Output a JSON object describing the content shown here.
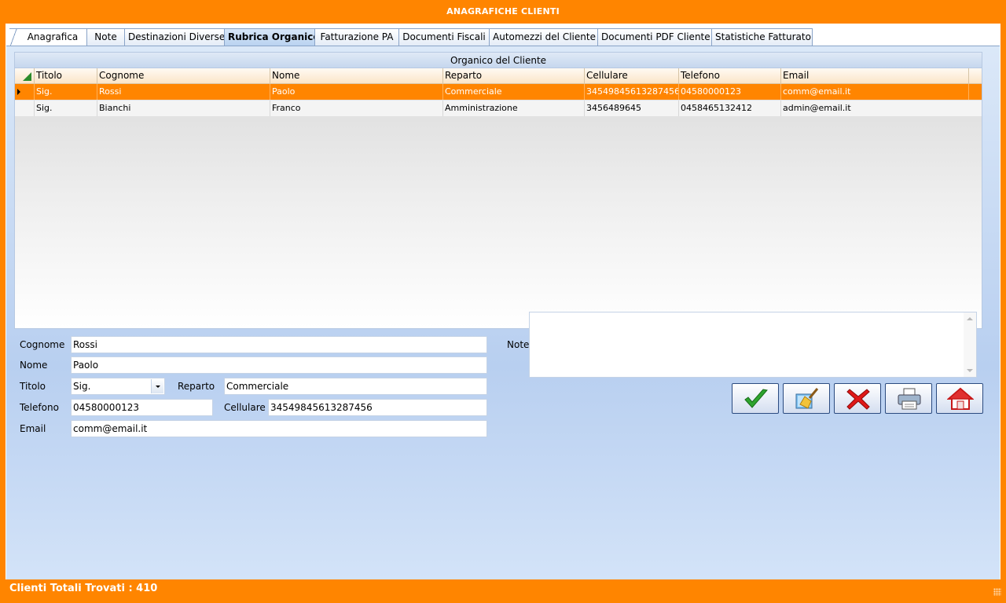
{
  "window": {
    "title": "ANAGRAFICHE CLIENTI"
  },
  "tabs": [
    {
      "label": "Anagrafica",
      "active": false
    },
    {
      "label": "Note",
      "active": false
    },
    {
      "label": "Destinazioni Diverse",
      "active": false
    },
    {
      "label": "Rubrica Organico",
      "active": true
    },
    {
      "label": "Fatturazione PA",
      "active": false
    },
    {
      "label": "Documenti Fiscali",
      "active": false
    },
    {
      "label": "Automezzi del Cliente",
      "active": false
    },
    {
      "label": "Documenti PDF Cliente",
      "active": false
    },
    {
      "label": "Statistiche Fatturato",
      "active": false
    }
  ],
  "grid": {
    "caption": "Organico del Cliente",
    "columns": [
      "Titolo",
      "Cognome",
      "Nome",
      "Reparto",
      "Cellulare",
      "Telefono",
      "Email"
    ],
    "rows": [
      {
        "selected": true,
        "cells": [
          "Sig.",
          "Rossi",
          "Paolo",
          "Commerciale",
          "34549845613287456",
          "04580000123",
          "comm@email.it"
        ]
      },
      {
        "selected": false,
        "cells": [
          "Sig.",
          "Bianchi",
          "Franco",
          "Amministrazione",
          "3456489645",
          "0458465132412",
          "admin@email.it"
        ]
      }
    ]
  },
  "form": {
    "cognome_label": "Cognome",
    "cognome_value": "Rossi",
    "nome_label": "Nome",
    "nome_value": "Paolo",
    "titolo_label": "Titolo",
    "titolo_value": "Sig.",
    "reparto_label": "Reparto",
    "reparto_value": "Commerciale",
    "telefono_label": "Telefono",
    "telefono_value": "04580000123",
    "cellulare_label": "Cellulare",
    "cellulare_value": "34549845613287456",
    "email_label": "Email",
    "email_value": "comm@email.it",
    "note_label": "Note",
    "note_value": ""
  },
  "actions": [
    {
      "name": "confirm",
      "icon": "checkmark-icon"
    },
    {
      "name": "clear",
      "icon": "broom-icon"
    },
    {
      "name": "delete",
      "icon": "red-x-icon"
    },
    {
      "name": "print",
      "icon": "printer-icon"
    },
    {
      "name": "home",
      "icon": "home-icon"
    }
  ],
  "status": {
    "text": "Clienti Totali Trovati : 410"
  },
  "colors": {
    "accent": "#FF8500",
    "panel": "#C6DAF4",
    "header_bg": "#FBE5C8"
  }
}
